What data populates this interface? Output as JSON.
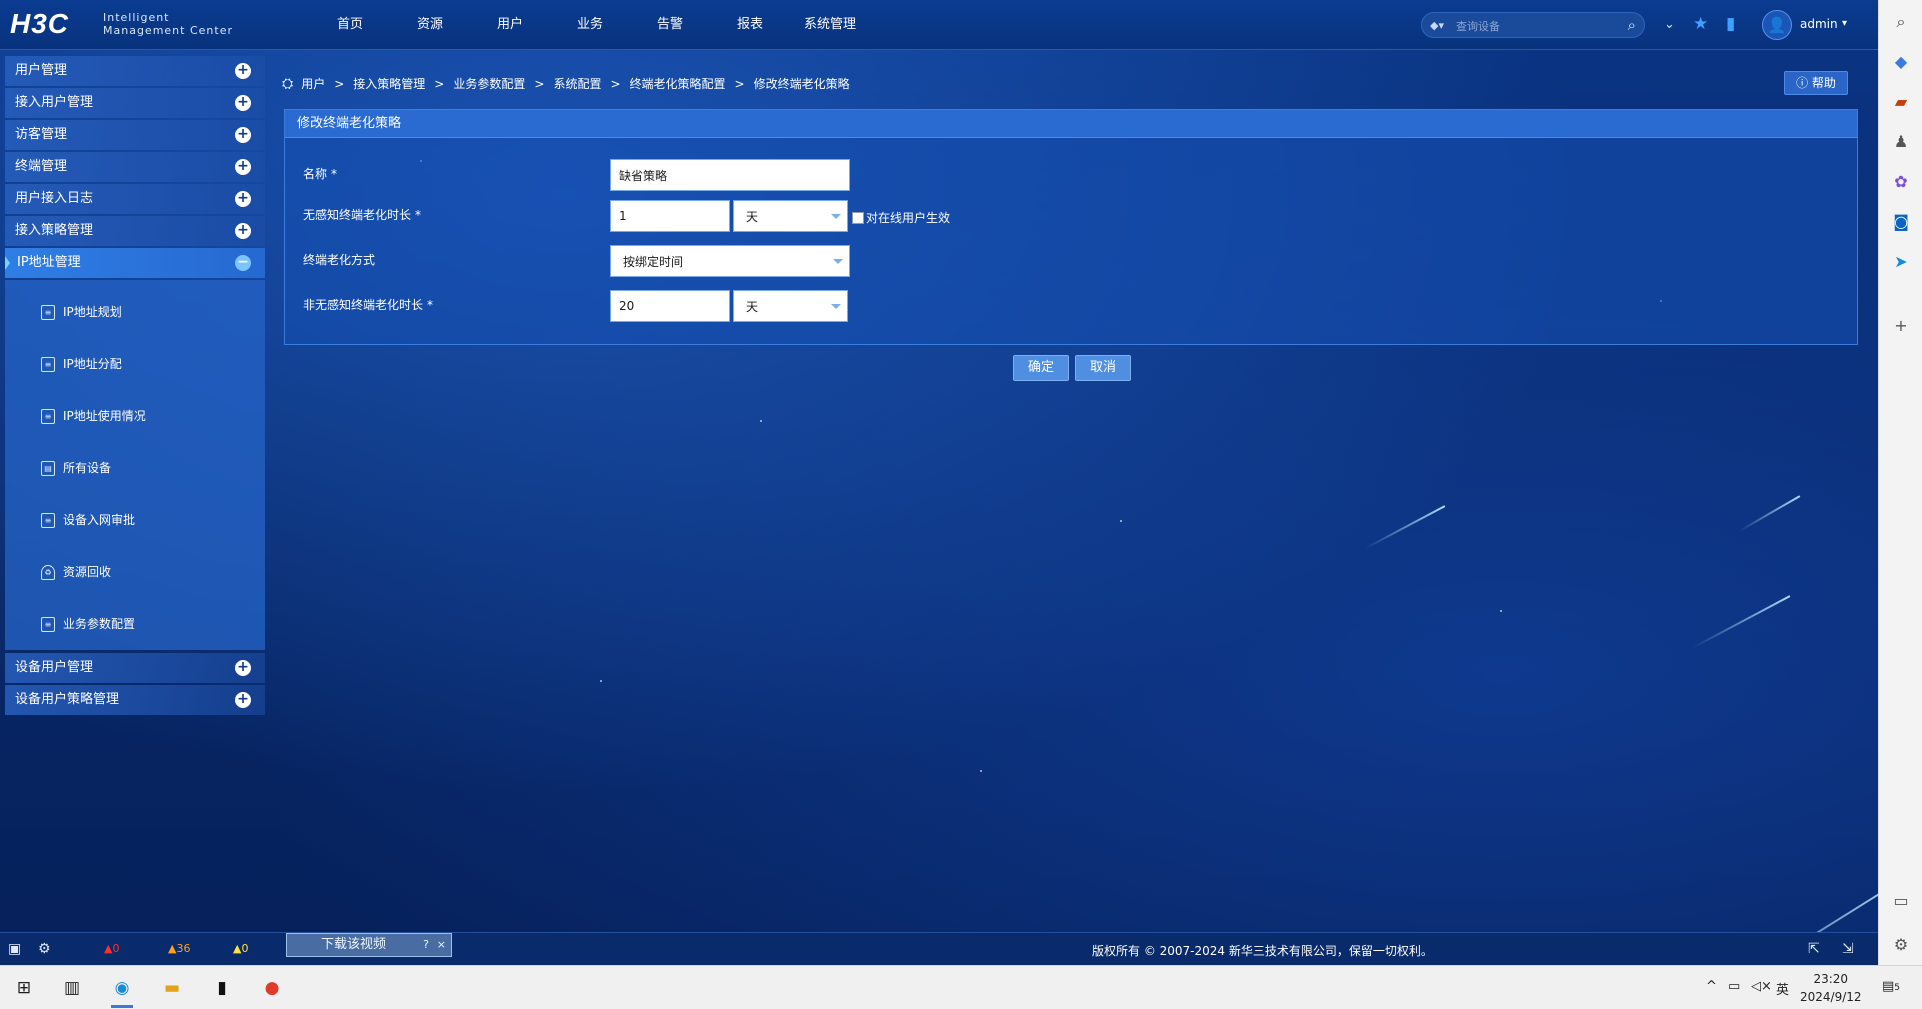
{
  "header": {
    "logo_text": "H3C",
    "logo_sub_line1": "Intelligent",
    "logo_sub_line2": "Management Center",
    "nav": [
      "首页",
      "资源",
      "用户",
      "业务",
      "告警",
      "报表",
      "系统管理"
    ],
    "search_placeholder": "查询设备",
    "username": "admin"
  },
  "sidebar": {
    "top_items": [
      "用户管理",
      "接入用户管理",
      "访客管理",
      "终端管理",
      "用户接入日志",
      "接入策略管理"
    ],
    "active_item": "IP地址管理",
    "sub_items": [
      "IP地址规划",
      "IP地址分配",
      "IP地址使用情况",
      "所有设备",
      "设备入网审批",
      "资源回收",
      "业务参数配置"
    ],
    "bottom_items": [
      "设备用户管理",
      "设备用户策略管理"
    ]
  },
  "breadcrumb": [
    "用户",
    "接入策略管理",
    "业务参数配置",
    "系统配置",
    "终端老化策略配置",
    "修改终端老化策略"
  ],
  "help_label": "帮助",
  "form": {
    "title": "修改终端老化策略",
    "name_label": "名称",
    "name_value": "缺省策略",
    "unaware_label": "无感知终端老化时长",
    "unaware_value": "1",
    "unaware_unit": "天",
    "online_checkbox_label": "对在线用户生效",
    "online_checkbox_checked": false,
    "method_label": "终端老化方式",
    "method_value": "按绑定时间",
    "nonaware_label": "非无感知终端老化时长",
    "nonaware_value": "20",
    "nonaware_unit": "天",
    "required_mark": "*"
  },
  "buttons": {
    "confirm": "确定",
    "cancel": "取消"
  },
  "statusbar": {
    "alarm_critical": "0",
    "alarm_major": "36",
    "alarm_minor": "0",
    "download_widget": "下载该视频",
    "download_help": "?",
    "download_close": "×",
    "copyright": "版权所有 © 2007-2024 新华三技术有限公司，保留一切权利。"
  },
  "taskbar": {
    "ime": "英",
    "time": "23:20",
    "date": "2024/9/12",
    "notification_count": "5"
  },
  "colors": {
    "accent": "#2f7ee6",
    "panel_title": "#2a6bd2",
    "alarm_critical": "#ff3030",
    "alarm_major": "#ffa020",
    "alarm_minor": "#ffe040"
  }
}
